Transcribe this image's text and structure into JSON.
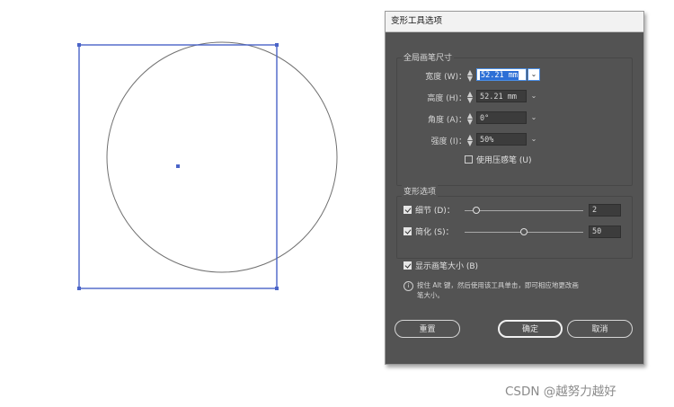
{
  "dialog": {
    "title": "变形工具选项",
    "brush_group": {
      "legend": "全局画笔尺寸",
      "width_label": "宽度 (W)：",
      "width_value": "52.21 mm",
      "height_label": "高度 (H)：",
      "height_value": "52.21 mm",
      "angle_label": "角度 (A)：",
      "angle_value": "0°",
      "intensity_label": "强度 (I)：",
      "intensity_value": "50%",
      "pressure_label": "使用压感笔 (U)",
      "pressure_checked": false
    },
    "morph_group": {
      "legend": "变形选项",
      "detail_label": "细节 (D)：",
      "detail_checked": true,
      "detail_value": "2",
      "detail_level": 0.1,
      "simplify_label": "简化 (S)：",
      "simplify_checked": true,
      "simplify_value": "50",
      "simplify_level": 0.5
    },
    "show_brush_label": "显示画笔大小 (B)",
    "show_brush_checked": true,
    "info_icon": "i",
    "info_line1": "按住 Alt 键，然后使用该工具单击，即可相应地更改画",
    "info_line2": "笔大小。",
    "reset_button": "重置",
    "ok_button": "确定",
    "cancel_button": "取消"
  },
  "watermark": "CSDN @越努力越好",
  "colors": {
    "selection_blue": "#4a64c8",
    "dialog_bg": "#535353",
    "circle_stroke": "#707070"
  }
}
